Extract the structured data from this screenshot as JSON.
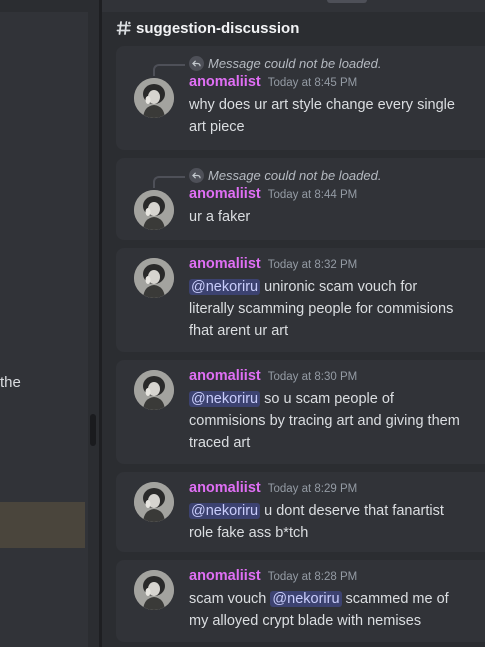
{
  "left": {
    "partial_text": "the"
  },
  "channel": {
    "name": "suggestion-discussion",
    "icon": "hash-thread-icon"
  },
  "colors": {
    "author": "#e06ff5",
    "mention_bg": "#3c4270",
    "card_bg": "#313338",
    "panel_bg": "#2b2d31"
  },
  "messages": [
    {
      "reply": "Message could not be loaded.",
      "author": "anomaliist",
      "time": "Today at 8:45 PM",
      "line1": "why does ur art style change every single",
      "line2": "art piece"
    },
    {
      "reply": "Message could not be loaded.",
      "author": "anomaliist",
      "time": "Today at 8:44 PM",
      "line1": "ur a faker"
    },
    {
      "author": "anomaliist",
      "time": "Today at 8:32 PM",
      "mention": "@nekoriru",
      "line1_rest": " unironic scam vouch for",
      "line2": "literally scamming people for commisions",
      "line3": "fhat arent ur art"
    },
    {
      "author": "anomaliist",
      "time": "Today at 8:30 PM",
      "mention": "@nekoriru",
      "line1_rest": " so u scam people of",
      "line2": "commisions by tracing art and giving them",
      "line3": "traced art"
    },
    {
      "author": "anomaliist",
      "time": "Today at 8:29 PM",
      "mention": "@nekoriru",
      "line1_rest": " u dont deserve that fanartist",
      "line2": "role fake ass b*tch"
    },
    {
      "author": "anomaliist",
      "time": "Today at 8:28 PM",
      "line1_pre": "scam vouch ",
      "mention": "@nekoriru",
      "line1_rest": " scammed me of",
      "line2": "my alloyed crypt blade with nemises"
    }
  ]
}
